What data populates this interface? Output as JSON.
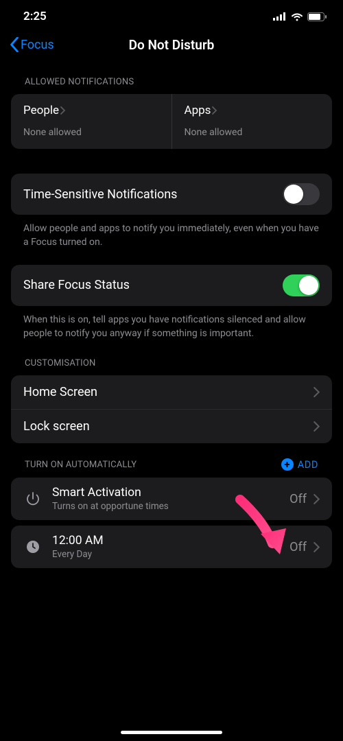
{
  "status": {
    "time": "2:25"
  },
  "nav": {
    "back": "Focus",
    "title": "Do Not Disturb"
  },
  "allowed": {
    "header": "ALLOWED NOTIFICATIONS",
    "people": {
      "title": "People",
      "sub": "None allowed"
    },
    "apps": {
      "title": "Apps",
      "sub": "None allowed"
    }
  },
  "timeSensitive": {
    "label": "Time-Sensitive Notifications",
    "on": false,
    "foot": "Allow people and apps to notify you immediately, even when you have a Focus turned on."
  },
  "shareStatus": {
    "label": "Share Focus Status",
    "on": true,
    "foot": "When this is on, tell apps you have notifications silenced and allow people to notify you anyway if something is important."
  },
  "customisation": {
    "header": "CUSTOMISATION",
    "home": "Home Screen",
    "lock": "Lock screen"
  },
  "auto": {
    "header": "TURN ON AUTOMATICALLY",
    "add": "ADD",
    "smart": {
      "title": "Smart Activation",
      "sub": "Turns on at opportune times",
      "value": "Off"
    },
    "sched": {
      "title": "12:00 AM",
      "sub": "Every Day",
      "value": "Off"
    }
  }
}
